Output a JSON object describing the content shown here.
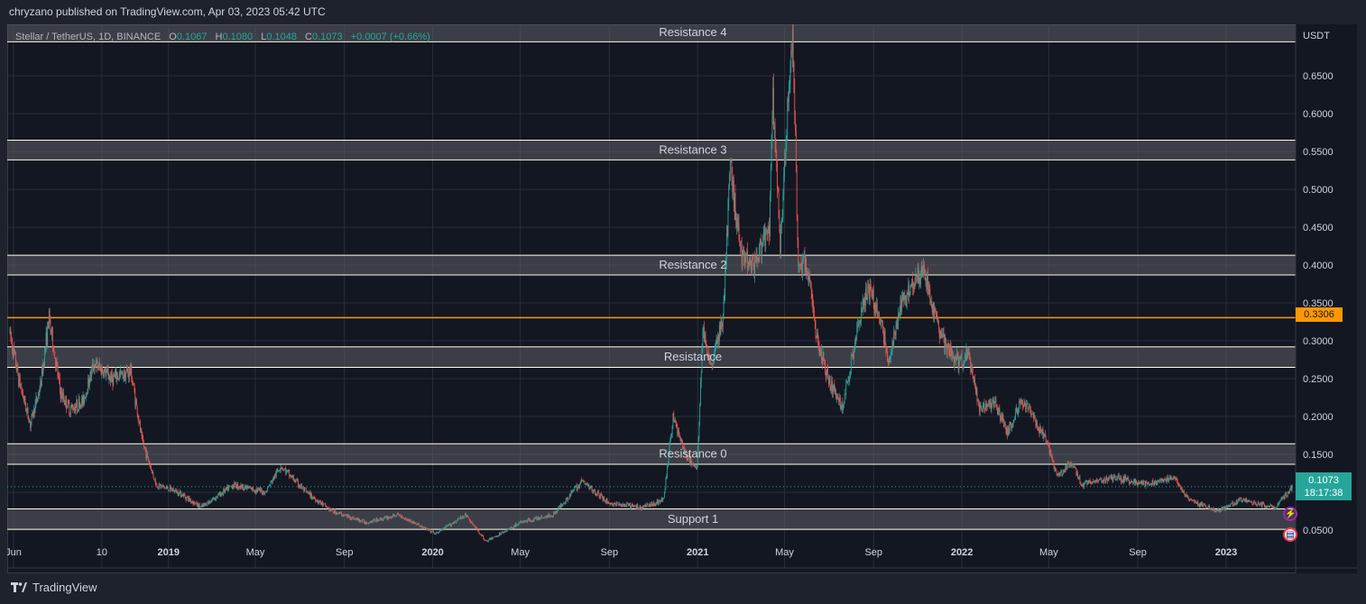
{
  "header": {
    "published": "chryzano published on TradingView.com, Apr 03, 2023 05:42 UTC"
  },
  "symbol": {
    "title": "Stellar / TetherUS, 1D, BINANCE",
    "open_label": "O",
    "open": "0.1067",
    "high_label": "H",
    "high": "0.1080",
    "low_label": "L",
    "low": "0.1048",
    "close_label": "C",
    "close": "0.1073",
    "change": "+0.0007 (+0.66%)"
  },
  "price_axis": {
    "currency": "USDT"
  },
  "current_price": {
    "price": "0.1073",
    "countdown": "18:17:38"
  },
  "marker_price": "0.3306",
  "footer": {
    "brand": "TradingView"
  },
  "colors": {
    "up": "#26a69a",
    "down": "#ef5350",
    "zone_line": "#fffde7",
    "zone_fill": "#5d5f66",
    "marker": "#ff9800"
  },
  "icons": [
    "lightning-icon",
    "us-flag-icon",
    "tradingview-logo-icon"
  ],
  "chart_data": {
    "type": "candlestick",
    "title": "",
    "ylim": [
      0.0,
      0.718
    ],
    "y_ticks": [
      {
        "v": 0.05,
        "label": "0.0500"
      },
      {
        "v": 0.1,
        "label": "0.1000"
      },
      {
        "v": 0.15,
        "label": "0.1500"
      },
      {
        "v": 0.2,
        "label": "0.2000"
      },
      {
        "v": 0.25,
        "label": "0.2500"
      },
      {
        "v": 0.3,
        "label": "0.3000"
      },
      {
        "v": 0.35,
        "label": "0.3500"
      },
      {
        "v": 0.4,
        "label": "0.4000"
      },
      {
        "v": 0.45,
        "label": "0.4500"
      },
      {
        "v": 0.5,
        "label": "0.5000"
      },
      {
        "v": 0.55,
        "label": "0.5500"
      },
      {
        "v": 0.6,
        "label": "0.6000"
      },
      {
        "v": 0.65,
        "label": "0.6500"
      }
    ],
    "x_ticks": [
      {
        "date": "2018-06-01",
        "label": "Jun"
      },
      {
        "date": "2018-10-01",
        "label": "10"
      },
      {
        "date": "2019-01-01",
        "label": "2019"
      },
      {
        "date": "2019-05-01",
        "label": "May"
      },
      {
        "date": "2019-09-01",
        "label": "Sep"
      },
      {
        "date": "2020-01-01",
        "label": "2020"
      },
      {
        "date": "2020-05-01",
        "label": "May"
      },
      {
        "date": "2020-09-01",
        "label": "Sep"
      },
      {
        "date": "2021-01-01",
        "label": "2021"
      },
      {
        "date": "2021-05-01",
        "label": "May"
      },
      {
        "date": "2021-09-01",
        "label": "Sep"
      },
      {
        "date": "2022-01-01",
        "label": "2022"
      },
      {
        "date": "2022-05-01",
        "label": "May"
      },
      {
        "date": "2022-09-01",
        "label": "Sep"
      },
      {
        "date": "2023-01-01",
        "label": "2023"
      }
    ],
    "zones": [
      {
        "label": "Resistance 4",
        "low": 0.695,
        "high": 0.72
      },
      {
        "label": "Resistance 3",
        "low": 0.539,
        "high": 0.565
      },
      {
        "label": "Resistance 2",
        "low": 0.387,
        "high": 0.413
      },
      {
        "label": "Resistance",
        "low": 0.265,
        "high": 0.292
      },
      {
        "label": "Resistance 0",
        "low": 0.137,
        "high": 0.164
      },
      {
        "label": "Support 1",
        "low": 0.051,
        "high": 0.078
      }
    ],
    "marker_line": 0.3306,
    "last_price": 0.1073,
    "price_path": [
      {
        "date": "2018-05-27",
        "price": 0.31
      },
      {
        "date": "2018-06-08",
        "price": 0.25
      },
      {
        "date": "2018-06-24",
        "price": 0.19
      },
      {
        "date": "2018-07-08",
        "price": 0.24
      },
      {
        "date": "2018-07-20",
        "price": 0.33
      },
      {
        "date": "2018-08-05",
        "price": 0.23
      },
      {
        "date": "2018-08-18",
        "price": 0.21
      },
      {
        "date": "2018-09-05",
        "price": 0.22
      },
      {
        "date": "2018-09-20",
        "price": 0.27
      },
      {
        "date": "2018-10-15",
        "price": 0.25
      },
      {
        "date": "2018-11-10",
        "price": 0.26
      },
      {
        "date": "2018-11-25",
        "price": 0.17
      },
      {
        "date": "2018-12-15",
        "price": 0.11
      },
      {
        "date": "2019-01-15",
        "price": 0.1
      },
      {
        "date": "2019-02-15",
        "price": 0.08
      },
      {
        "date": "2019-04-01",
        "price": 0.11
      },
      {
        "date": "2019-05-15",
        "price": 0.1
      },
      {
        "date": "2019-06-05",
        "price": 0.135
      },
      {
        "date": "2019-07-10",
        "price": 0.1
      },
      {
        "date": "2019-08-15",
        "price": 0.075
      },
      {
        "date": "2019-10-01",
        "price": 0.06
      },
      {
        "date": "2019-11-15",
        "price": 0.07
      },
      {
        "date": "2020-01-05",
        "price": 0.045
      },
      {
        "date": "2020-02-15",
        "price": 0.07
      },
      {
        "date": "2020-03-15",
        "price": 0.035
      },
      {
        "date": "2020-05-01",
        "price": 0.06
      },
      {
        "date": "2020-06-15",
        "price": 0.07
      },
      {
        "date": "2020-07-25",
        "price": 0.115
      },
      {
        "date": "2020-09-01",
        "price": 0.085
      },
      {
        "date": "2020-10-15",
        "price": 0.08
      },
      {
        "date": "2020-11-15",
        "price": 0.09
      },
      {
        "date": "2020-11-28",
        "price": 0.2
      },
      {
        "date": "2020-12-15",
        "price": 0.15
      },
      {
        "date": "2020-12-31",
        "price": 0.13
      },
      {
        "date": "2021-01-08",
        "price": 0.31
      },
      {
        "date": "2021-01-20",
        "price": 0.27
      },
      {
        "date": "2021-02-05",
        "price": 0.33
      },
      {
        "date": "2021-02-15",
        "price": 0.53
      },
      {
        "date": "2021-03-01",
        "price": 0.42
      },
      {
        "date": "2021-03-20",
        "price": 0.4
      },
      {
        "date": "2021-04-10",
        "price": 0.45
      },
      {
        "date": "2021-04-15",
        "price": 0.62
      },
      {
        "date": "2021-04-25",
        "price": 0.42
      },
      {
        "date": "2021-05-12",
        "price": 0.72
      },
      {
        "date": "2021-05-20",
        "price": 0.4
      },
      {
        "date": "2021-06-01",
        "price": 0.4
      },
      {
        "date": "2021-06-15",
        "price": 0.3
      },
      {
        "date": "2021-07-01",
        "price": 0.25
      },
      {
        "date": "2021-07-20",
        "price": 0.21
      },
      {
        "date": "2021-08-10",
        "price": 0.32
      },
      {
        "date": "2021-08-25",
        "price": 0.37
      },
      {
        "date": "2021-09-10",
        "price": 0.33
      },
      {
        "date": "2021-09-22",
        "price": 0.27
      },
      {
        "date": "2021-10-10",
        "price": 0.35
      },
      {
        "date": "2021-10-25",
        "price": 0.38
      },
      {
        "date": "2021-11-10",
        "price": 0.39
      },
      {
        "date": "2021-11-25",
        "price": 0.33
      },
      {
        "date": "2021-12-10",
        "price": 0.29
      },
      {
        "date": "2021-12-28",
        "price": 0.27
      },
      {
        "date": "2022-01-10",
        "price": 0.28
      },
      {
        "date": "2022-01-25",
        "price": 0.21
      },
      {
        "date": "2022-02-15",
        "price": 0.22
      },
      {
        "date": "2022-03-05",
        "price": 0.18
      },
      {
        "date": "2022-03-25",
        "price": 0.22
      },
      {
        "date": "2022-04-10",
        "price": 0.2
      },
      {
        "date": "2022-05-01",
        "price": 0.16
      },
      {
        "date": "2022-05-12",
        "price": 0.12
      },
      {
        "date": "2022-06-01",
        "price": 0.14
      },
      {
        "date": "2022-06-15",
        "price": 0.11
      },
      {
        "date": "2022-08-01",
        "price": 0.12
      },
      {
        "date": "2022-09-15",
        "price": 0.11
      },
      {
        "date": "2022-10-20",
        "price": 0.12
      },
      {
        "date": "2022-11-10",
        "price": 0.09
      },
      {
        "date": "2022-12-20",
        "price": 0.075
      },
      {
        "date": "2023-01-20",
        "price": 0.09
      },
      {
        "date": "2023-03-10",
        "price": 0.08
      },
      {
        "date": "2023-04-02",
        "price": 0.107
      }
    ],
    "series": [
      {
        "name": "Stellar / TetherUS",
        "values": "price_path"
      }
    ]
  }
}
